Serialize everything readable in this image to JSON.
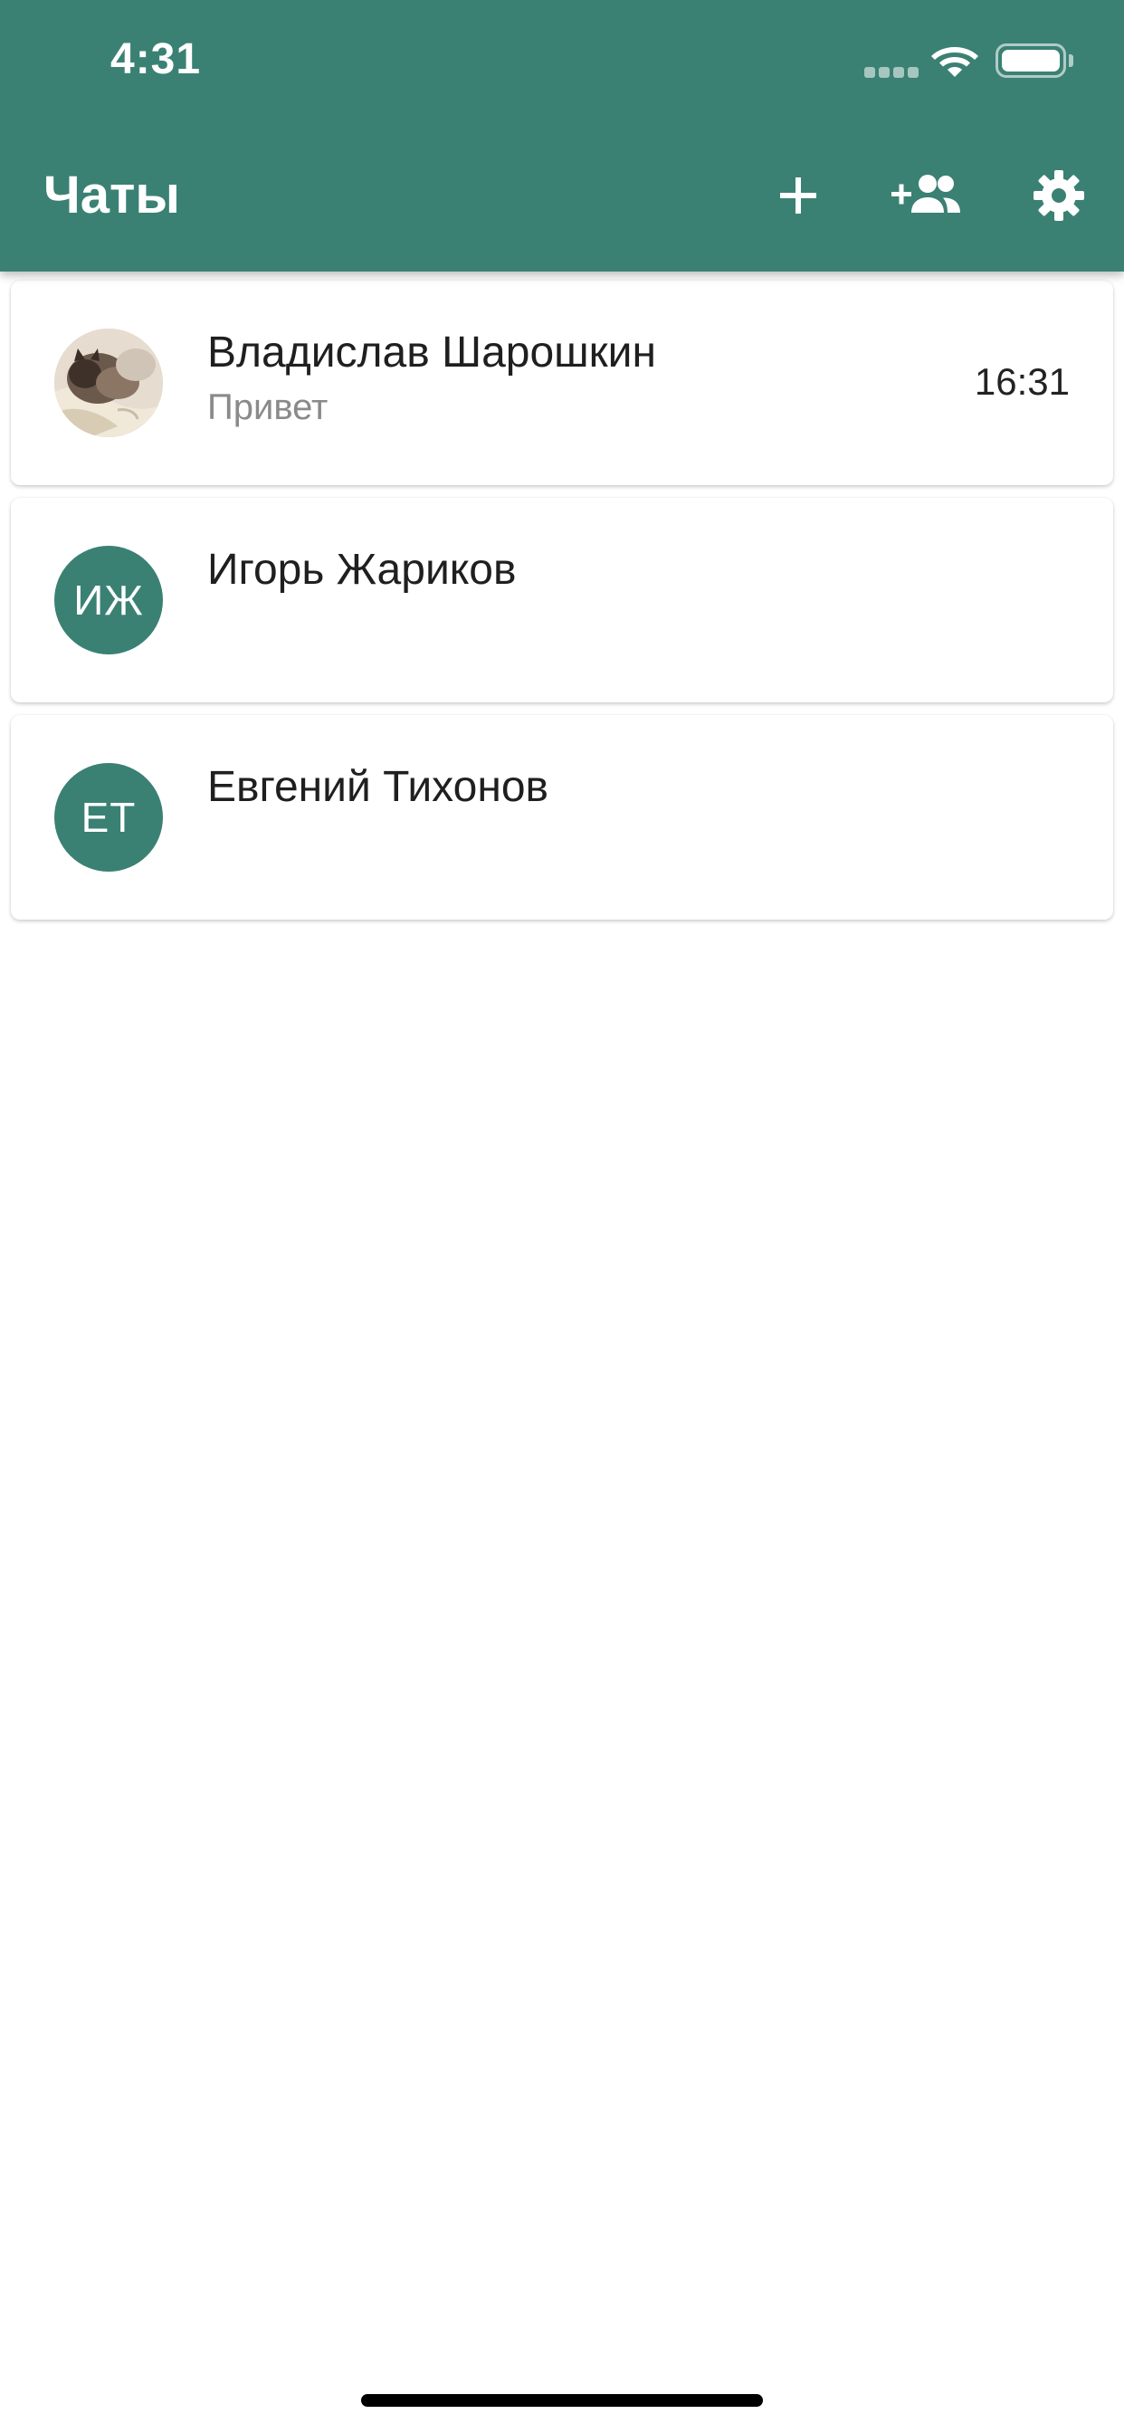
{
  "status_bar": {
    "time": "4:31",
    "icons": [
      "cellular-signal-icon",
      "wifi-icon",
      "battery-icon"
    ]
  },
  "app_bar": {
    "title": "Чаты",
    "actions": [
      {
        "name": "add-chat",
        "icon": "plus-icon"
      },
      {
        "name": "contacts",
        "icon": "add-contact-icon"
      },
      {
        "name": "settings",
        "icon": "gear-icon"
      }
    ]
  },
  "chats": [
    {
      "name": "Владислав Шарошкин",
      "last_message": "Привет",
      "time": "16:31",
      "avatar": "photo",
      "initials": ""
    },
    {
      "name": "Игорь Жариков",
      "last_message": "",
      "time": "",
      "avatar": "initials",
      "initials": "ИЖ"
    },
    {
      "name": "Евгений Тихонов",
      "last_message": "",
      "time": "",
      "avatar": "initials",
      "initials": "ЕТ"
    }
  ],
  "colors": {
    "primary": "#3a8174",
    "text_primary": "#1f1f1f",
    "text_secondary": "#8a8a8a",
    "background": "#ffffff"
  }
}
